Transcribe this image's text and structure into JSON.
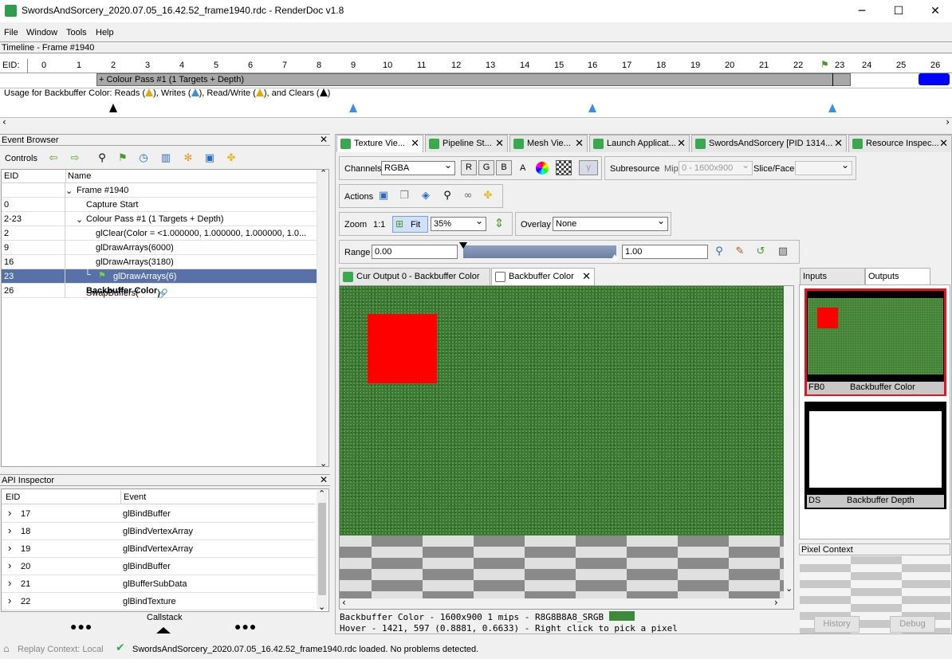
{
  "window": {
    "title": "SwordsAndSorcery_2020.07.05_16.42.52_frame1940.rdc - RenderDoc v1.8",
    "minimize": "─",
    "maximize": "☐",
    "close": "✕"
  },
  "menu": [
    "File",
    "Window",
    "Tools",
    "Help"
  ],
  "timeline": {
    "title": "Timeline - Frame #1940",
    "eid_label": "EID:",
    "ticks": [
      "0",
      "1",
      "2",
      "3",
      "4",
      "5",
      "6",
      "7",
      "8",
      "9",
      "10",
      "11",
      "12",
      "13",
      "14",
      "15",
      "16",
      "17",
      "18",
      "19",
      "20",
      "21",
      "22",
      "23",
      "24",
      "25",
      "26"
    ],
    "pass_label": "+ Colour Pass #1 (1 Targets + Depth)",
    "usage": "Usage for Backbuffer Color: Reads (▲), Writes (▲), Read/Write (▲), and Clears (▲)",
    "usage_parts": {
      "a": "Usage for Backbuffer Color: Reads (",
      "b": "), Writes (",
      "c": "), Read/Write (",
      "d": "), and Clears (",
      "e": ")"
    }
  },
  "event_browser": {
    "title": "Event Browser",
    "controls_label": "Controls",
    "col_eid": "EID",
    "col_name": "Name",
    "rows": [
      {
        "eid": "",
        "name": "Frame #1940"
      },
      {
        "eid": "0",
        "name": "Capture Start"
      },
      {
        "eid": "2-23",
        "name": "Colour Pass #1 (1 Targets + Depth)"
      },
      {
        "eid": "2",
        "name": "glClear(Color = <1.000000, 1.000000, 1.000000, 1.0..."
      },
      {
        "eid": "9",
        "name": "glDrawArrays(6000)"
      },
      {
        "eid": "16",
        "name": "glDrawArrays(3180)"
      },
      {
        "eid": "23",
        "name": "glDrawArrays(6)"
      },
      {
        "eid": "26",
        "name": "SwapBuffers(",
        "name_bold": "Backbuffer Color",
        "name_end": ")"
      }
    ]
  },
  "api_inspector": {
    "title": "API Inspector",
    "col_eid": "EID",
    "col_event": "Event",
    "rows": [
      {
        "eid": "17",
        "event": "glBindBuffer"
      },
      {
        "eid": "18",
        "event": "glBindVertexArray"
      },
      {
        "eid": "19",
        "event": "glBindVertexArray"
      },
      {
        "eid": "20",
        "event": "glBindBuffer"
      },
      {
        "eid": "21",
        "event": "glBufferSubData"
      },
      {
        "eid": "22",
        "event": "glBindTexture"
      }
    ],
    "callstack_label": "Callstack",
    "dots": "●●●"
  },
  "tabs": [
    "Texture Vie...",
    "Pipeline St...",
    "Mesh Vie...",
    "Launch Applicat...",
    "SwordsAndSorcery [PID 1314...",
    "Resource Inspec..."
  ],
  "toolbar": {
    "channels_label": "Channels",
    "channels_value": "RGBA",
    "r": "R",
    "g": "G",
    "b": "B",
    "a": "A",
    "gamma": "γ",
    "subresource_label": "Subresource",
    "mip_label": "Mip",
    "mip_value": "0 - 1600x900",
    "slice_label": "Slice/Face",
    "actions_label": "Actions",
    "zoom_label": "Zoom",
    "zoom_11": "1:1",
    "fit_label": "Fit",
    "zoom_value": "35%",
    "overlay_label": "Overlay",
    "overlay_value": "None",
    "range_label": "Range",
    "range_min": "0.00",
    "range_max": "1.00"
  },
  "texture_tabs": [
    "Cur Output 0 - Backbuffer Color",
    "Backbuffer Color"
  ],
  "status_lines": {
    "line1": "Backbuffer Color - 1600x900 1 mips - R8G8B8A8_SRGB",
    "line2": "Hover -  1421,  597 (0.8881, 0.6633)  - Right click to pick a pixel"
  },
  "side_tabs": [
    "Inputs",
    "Outputs"
  ],
  "thumbs": [
    {
      "slot": "FB0",
      "name": "Backbuffer Color"
    },
    {
      "slot": "DS",
      "name": "Backbuffer Depth"
    }
  ],
  "pixel_context": {
    "title": "Pixel Context",
    "history": "History",
    "debug": "Debug"
  },
  "statusbar": {
    "replay": "Replay Context: Local",
    "message": "SwordsAndSorcery_2020.07.05_16.42.52_frame1940.rdc loaded. No problems detected."
  },
  "colors": {
    "accent_select": "#5872a8",
    "grass": "#3d7a35",
    "red": "#ff0000",
    "blue": "#0000ff",
    "highlight": "#e81123"
  }
}
